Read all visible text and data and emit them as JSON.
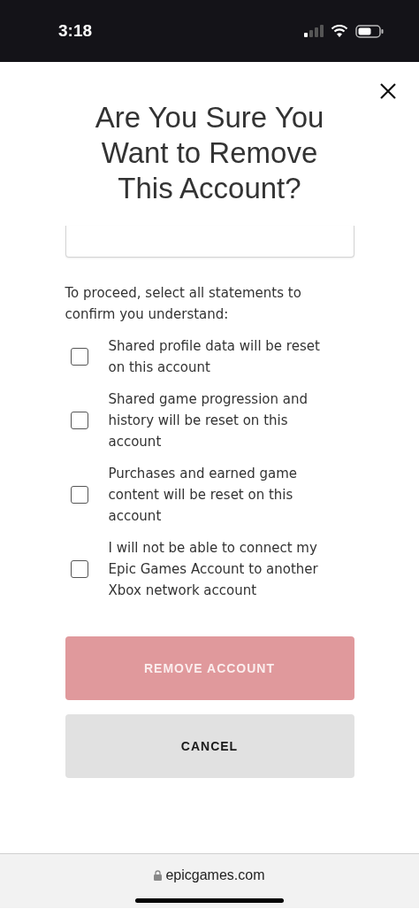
{
  "status_bar": {
    "time": "3:18"
  },
  "dialog": {
    "title": "Are You Sure You Want to Remove This Account?",
    "instructions": "To proceed, select all statements to confirm you understand:",
    "statements": [
      {
        "label": "Shared profile data will be reset on this account",
        "checked": false
      },
      {
        "label": "Shared game progression and history will be reset on this account",
        "checked": false
      },
      {
        "label": "Purchases and earned game content will be reset on this account",
        "checked": false
      },
      {
        "label": "I will not be able to connect my Epic Games Account to another Xbox network account",
        "checked": false
      }
    ],
    "buttons": [
      {
        "label": "REMOVE ACCOUNT",
        "kind": "danger",
        "disabled": true
      },
      {
        "label": "CANCEL",
        "kind": "secondary",
        "disabled": false
      }
    ]
  },
  "address_bar": {
    "url": "epicgames.com"
  }
}
